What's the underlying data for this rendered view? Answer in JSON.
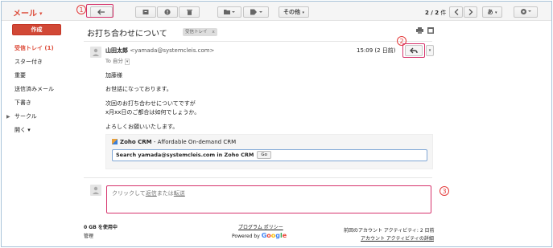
{
  "app": {
    "title": "メール",
    "title_caret": "▾"
  },
  "toolbar": {
    "buttons": [
      "back",
      "archive",
      "report-spam",
      "delete",
      "move-to",
      "labels"
    ],
    "more_label": "その他",
    "pager_current": "2 / 2",
    "pager_unit": "件",
    "input_tool_label": "あ",
    "settings": "settings"
  },
  "callouts": {
    "one": "1",
    "two": "2",
    "three": "3"
  },
  "compose_label": "作成",
  "nav": [
    {
      "label": "受信トレイ (1)",
      "active": true
    },
    {
      "label": "スター付き"
    },
    {
      "label": "重要"
    },
    {
      "label": "送信済みメール"
    },
    {
      "label": "下書き"
    },
    {
      "label": "サークル",
      "expandable": true
    },
    {
      "label": "開く ▾"
    }
  ],
  "message": {
    "subject": "お打ち合わせについて",
    "label_chip": "受信トレイ",
    "label_chip_close": "x",
    "sender_name": "山田太郎",
    "sender_email": "<yamada@systemcleis.com>",
    "to": "To 自分",
    "time": "15:09 (2 日前)",
    "body": [
      "加藤様",
      "お世話になっております。",
      "次回のお打ち合わせについてですが",
      "x月xx日のご都合は如何でしょうか。",
      "よろしくお願いいたします。"
    ]
  },
  "zoho": {
    "name": "Zoho CRM",
    "tagline": " - Affordable On-demand CRM",
    "search_text": "Search yamada@systemcleis.com in Zoho CRM",
    "go_label": "Go"
  },
  "reply": {
    "prefix": "クリックして",
    "reply_link": "返信",
    "mid": "または",
    "forward_link": "転送"
  },
  "footer": {
    "usage": "0 GB を使用中",
    "manage": "管理",
    "policy": "プログラム ポリシー",
    "powered_by": "Powered by",
    "google": "Google",
    "last_activity": "前回のアカウント アクティビティ: 2 日前",
    "activity_details": "アカウント アクティビティの詳細"
  }
}
